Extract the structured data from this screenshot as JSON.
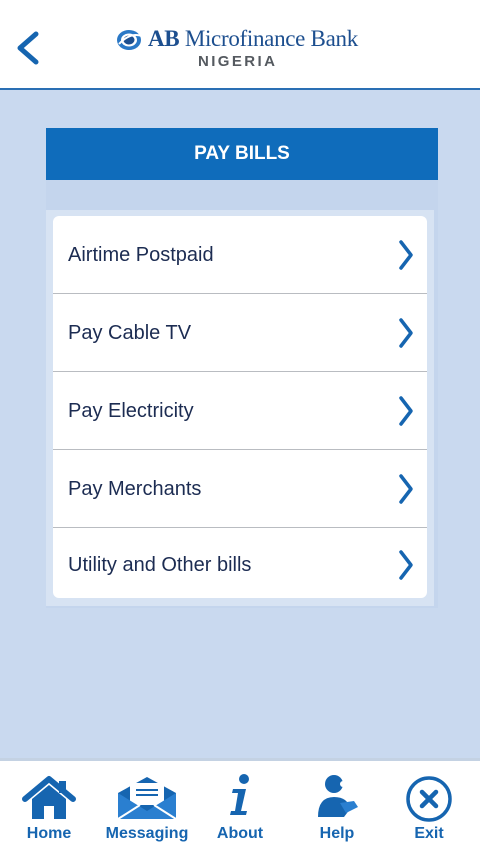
{
  "header": {
    "back_icon": "chevron-left-icon",
    "logo": {
      "name_bold": "AB",
      "name_rest": "Microfinance Bank",
      "country": "NIGERIA"
    }
  },
  "pay_bills": {
    "title": "PAY BILLS",
    "items": [
      {
        "label": "Airtime Postpaid",
        "icon": "chevron-right-icon"
      },
      {
        "label": "Pay Cable TV",
        "icon": "chevron-right-icon"
      },
      {
        "label": "Pay Electricity",
        "icon": "chevron-right-icon"
      },
      {
        "label": "Pay Merchants",
        "icon": "chevron-right-icon"
      },
      {
        "label": "Utility and Other bills",
        "icon": "chevron-right-icon"
      }
    ]
  },
  "bottom_nav": {
    "items": [
      {
        "label": "Home",
        "icon": "home-icon"
      },
      {
        "label": "Messaging",
        "icon": "envelope-icon"
      },
      {
        "label": "About",
        "icon": "info-icon"
      },
      {
        "label": "Help",
        "icon": "support-agent-icon"
      },
      {
        "label": "Exit",
        "icon": "close-circle-icon"
      }
    ]
  },
  "colors": {
    "primary": "#0f6cbb",
    "background": "#c9d9ef",
    "text_dark": "#1c2c52",
    "nav_label": "#1665b0"
  }
}
